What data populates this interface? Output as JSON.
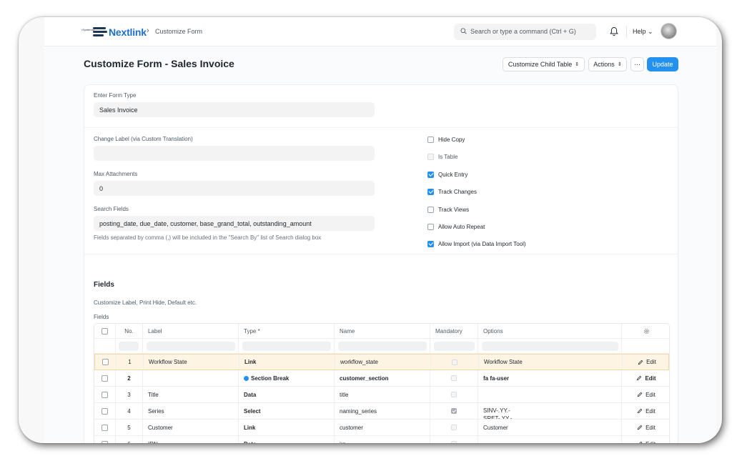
{
  "navbar": {
    "brand": "Nextlink",
    "brand_sub": "•Systems•",
    "breadcrumb_sep": "›",
    "breadcrumb": "Customize Form",
    "search_placeholder": "Search or type a command (Ctrl + G)",
    "help": "Help"
  },
  "page": {
    "title": "Customize Form - Sales Invoice",
    "buttons": {
      "customize_child": "Customize Child Table",
      "actions": "Actions",
      "more": "···",
      "update": "Update"
    }
  },
  "form": {
    "form_type_label": "Enter Form Type",
    "form_type_value": "Sales Invoice",
    "change_label_label": "Change Label (via Custom Translation)",
    "change_label_value": "",
    "max_attachments_label": "Max Attachments",
    "max_attachments_value": "0",
    "search_fields_label": "Search Fields",
    "search_fields_value": "posting_date, due_date, customer, base_grand_total, outstanding_amount",
    "search_fields_hint": "Fields separated by comma (,) will be included in the \"Search By\" list of Search dialog box",
    "checks": [
      {
        "label": "Hide Copy",
        "checked": false,
        "disabled": false
      },
      {
        "label": "Is Table",
        "checked": false,
        "disabled": true
      },
      {
        "label": "Quick Entry",
        "checked": true,
        "disabled": false
      },
      {
        "label": "Track Changes",
        "checked": true,
        "disabled": false
      },
      {
        "label": "Track Views",
        "checked": false,
        "disabled": false
      },
      {
        "label": "Allow Auto Repeat",
        "checked": false,
        "disabled": false
      },
      {
        "label": "Allow Import (via Data Import Tool)",
        "checked": true,
        "disabled": false
      }
    ]
  },
  "fields_section": {
    "heading": "Fields",
    "description": "Customize Label, Print Hide, Default etc.",
    "grid_label": "Fields",
    "columns": [
      "No.",
      "Label",
      "Type *",
      "Name",
      "Mandatory",
      "Options"
    ],
    "edit_label": "Edit",
    "rows": [
      {
        "no": "1",
        "label": "Workflow State",
        "type": "Link",
        "name": "workflow_state",
        "mandatory": false,
        "options": "Workflow State",
        "highlight": true
      },
      {
        "no": "2",
        "label": "",
        "type": "Section Break",
        "name": "customer_section",
        "mandatory": false,
        "options": "fa fa-user",
        "bold": true
      },
      {
        "no": "3",
        "label": "Title",
        "type": "Data",
        "name": "title",
        "mandatory": false,
        "options": ""
      },
      {
        "no": "4",
        "label": "Series",
        "type": "Select",
        "name": "naming_series",
        "mandatory": true,
        "options": "SINV-.YY.-\nSRET-.YY.-"
      },
      {
        "no": "5",
        "label": "Customer",
        "type": "Link",
        "name": "customer",
        "mandatory": false,
        "options": "Customer"
      },
      {
        "no": "6",
        "label": "IRN",
        "type": "Data",
        "name": "irn",
        "mandatory": false,
        "options": ""
      }
    ]
  }
}
